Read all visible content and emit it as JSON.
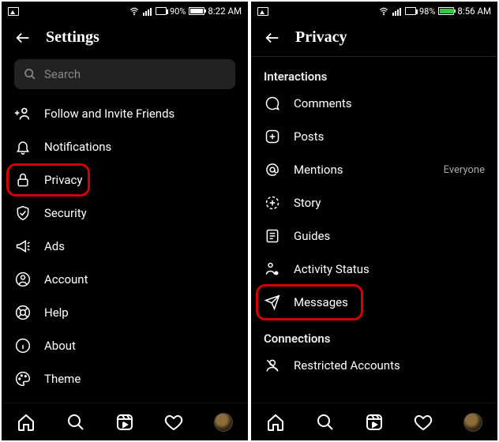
{
  "left": {
    "status": {
      "battery_pct": "90%",
      "time": "8:22 AM"
    },
    "title": "Settings",
    "search_placeholder": "Search",
    "items": [
      {
        "icon": "add-friends-icon",
        "label": "Follow and Invite Friends",
        "highlight": false
      },
      {
        "icon": "bell-icon",
        "label": "Notifications",
        "highlight": false
      },
      {
        "icon": "lock-icon",
        "label": "Privacy",
        "highlight": true
      },
      {
        "icon": "shield-icon",
        "label": "Security",
        "highlight": false
      },
      {
        "icon": "megaphone-icon",
        "label": "Ads",
        "highlight": false
      },
      {
        "icon": "person-icon",
        "label": "Account",
        "highlight": false
      },
      {
        "icon": "lifebuoy-icon",
        "label": "Help",
        "highlight": false
      },
      {
        "icon": "info-icon",
        "label": "About",
        "highlight": false
      },
      {
        "icon": "palette-icon",
        "label": "Theme",
        "highlight": false
      }
    ]
  },
  "right": {
    "status": {
      "battery_pct": "98%",
      "time": "8:56 AM",
      "charging": true
    },
    "title": "Privacy",
    "section1": "Interactions",
    "section2": "Connections",
    "items1": [
      {
        "icon": "comment-icon",
        "label": "Comments",
        "trail": "",
        "highlight": false
      },
      {
        "icon": "plus-square-icon",
        "label": "Posts",
        "trail": "",
        "highlight": false
      },
      {
        "icon": "at-icon",
        "label": "Mentions",
        "trail": "Everyone",
        "highlight": false
      },
      {
        "icon": "story-icon",
        "label": "Story",
        "trail": "",
        "highlight": false
      },
      {
        "icon": "guides-icon",
        "label": "Guides",
        "trail": "",
        "highlight": false
      },
      {
        "icon": "activity-icon",
        "label": "Activity Status",
        "trail": "",
        "highlight": false
      },
      {
        "icon": "send-icon",
        "label": "Messages",
        "trail": "",
        "highlight": true
      }
    ],
    "items2": [
      {
        "icon": "restrict-icon",
        "label": "Restricted Accounts",
        "trail": "",
        "highlight": false
      }
    ]
  }
}
